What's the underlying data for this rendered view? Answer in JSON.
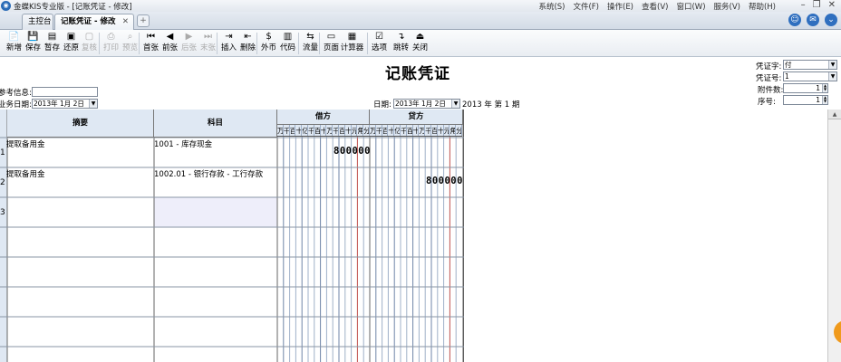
{
  "window": {
    "title": "金蝶KIS专业版 - [记账凭证 - 修改]",
    "app_icon_glyph": "◉",
    "menu": [
      "系统(S)",
      "文件(F)",
      "操作(E)",
      "查看(V)",
      "窗口(W)",
      "服务(V)",
      "帮助(H)"
    ],
    "controls": {
      "minimize": "–",
      "restore": "❐",
      "close": "✕"
    }
  },
  "tabs": {
    "home_label": "主控台",
    "active_label": "记账凭证 - 修改",
    "close_glyph": "✕",
    "new_glyph": "+"
  },
  "toolbar": [
    {
      "label": "新增",
      "icon": "📄",
      "enabled": true
    },
    {
      "label": "保存",
      "icon": "💾",
      "enabled": true
    },
    {
      "label": "暂存",
      "icon": "▤",
      "enabled": true
    },
    {
      "label": "还原",
      "icon": "▣",
      "enabled": true
    },
    {
      "label": "复核",
      "icon": "▢",
      "enabled": false
    },
    {
      "label": "打印",
      "icon": "⎙",
      "enabled": false
    },
    {
      "label": "预览",
      "icon": "⌕",
      "enabled": false
    },
    {
      "label": "首张",
      "icon": "⏮",
      "enabled": true
    },
    {
      "label": "前张",
      "icon": "◀",
      "enabled": true
    },
    {
      "label": "后张",
      "icon": "▶",
      "enabled": false
    },
    {
      "label": "末张",
      "icon": "⏭",
      "enabled": false
    },
    {
      "label": "插入",
      "icon": "⇥",
      "enabled": true
    },
    {
      "label": "删除",
      "icon": "⇤",
      "enabled": true
    },
    {
      "label": "外币",
      "icon": "$",
      "enabled": true
    },
    {
      "label": "代码",
      "icon": "▥",
      "enabled": true
    },
    {
      "label": "流量",
      "icon": "⇆",
      "enabled": true
    },
    {
      "label": "页面",
      "icon": "▭",
      "enabled": true
    },
    {
      "label": "计算器",
      "icon": "▦",
      "enabled": true
    },
    {
      "label": "选项",
      "icon": "☑",
      "enabled": true
    },
    {
      "label": "跳转",
      "icon": "↴",
      "enabled": true
    },
    {
      "label": "关闭",
      "icon": "⏏",
      "enabled": true
    }
  ],
  "form": {
    "title": "记账凭证",
    "ref_label": "参考信息:",
    "ref_value": "",
    "biz_date_label": "业务日期:",
    "biz_date_value": "2013年 1月 2日",
    "date_label": "日期:",
    "date_value": "2013年 1月 2日",
    "period_text": "2013 年 第 1 期",
    "voucher_word_label": "凭证字:",
    "voucher_word_value": "付",
    "voucher_no_label": "凭证号:",
    "voucher_no_value": "1",
    "attach_label": "附件数:",
    "attach_value": "1",
    "seq_label": "序号:",
    "seq_value": "1"
  },
  "grid": {
    "headers": {
      "summary": "摘要",
      "account": "科目",
      "debit": "借方",
      "credit": "贷方"
    },
    "digit_labels": [
      "万",
      "千",
      "百",
      "十",
      "亿",
      "千",
      "百",
      "十",
      "万",
      "千",
      "百",
      "十",
      "元",
      "角",
      "分"
    ],
    "rows": [
      {
        "num": "1",
        "summary": "提取备用金",
        "account": "1001 - 库存现金",
        "debit": "800000",
        "credit": ""
      },
      {
        "num": "2",
        "summary": "提取备用金",
        "account": "1002.01 - 银行存款 - 工行存款",
        "debit": "",
        "credit": "800000"
      },
      {
        "num": "3",
        "summary": "",
        "account": "",
        "debit": "",
        "credit": ""
      }
    ]
  },
  "colors": {
    "header_bg": "#dfe8f3",
    "digit_line": "#9fb0c8",
    "yuan_line": "#c0504d",
    "selected_cell": "#eeeefa"
  }
}
